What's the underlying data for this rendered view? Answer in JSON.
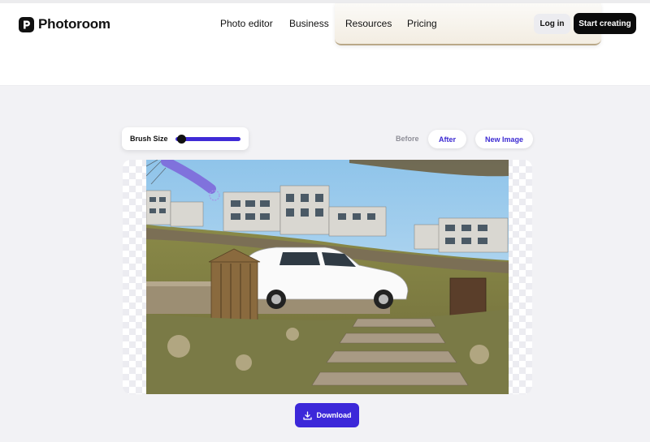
{
  "brand": {
    "name": "Photoroom"
  },
  "nav": {
    "items": [
      {
        "label": "Photo editor"
      },
      {
        "label": "Business"
      },
      {
        "label": "Resources"
      },
      {
        "label": "Pricing"
      }
    ]
  },
  "header": {
    "login_label": "Log in",
    "cta_label": "Start creating"
  },
  "editor": {
    "brush_size_label": "Brush Size",
    "brush_size_level": 0.05,
    "before_label": "Before",
    "after_label": "After",
    "new_image_label": "New Image",
    "download_label": "Download"
  },
  "colors": {
    "accent": "#3c28d9",
    "cta": "#0b0b0b",
    "page_bg": "#f2f2f5",
    "brush_stroke": "#7c63d9"
  },
  "icons": [
    "photoroom-logo-icon",
    "download-icon",
    "brush-cursor-icon"
  ]
}
